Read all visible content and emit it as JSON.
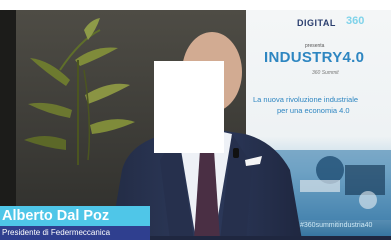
{
  "lower_third": {
    "name": "Alberto Dal Poz",
    "role": "Presidente di Federmeccanica"
  },
  "banner": {
    "brand": "DIGITAL",
    "brand_number": "360",
    "presenta": "presenta",
    "event": "INDUSTRY4.0",
    "sub": "360 Summit",
    "tagline_1": "La nuova rivoluzione industriale",
    "tagline_2": "per una economia 4.0",
    "hashtag": "#360summitindustria40"
  },
  "colors": {
    "name_bar": "#4fc6e8",
    "role_bar": "#2f3f8f",
    "banner_blue": "#2e86c1",
    "redaction": "#ffffff"
  }
}
